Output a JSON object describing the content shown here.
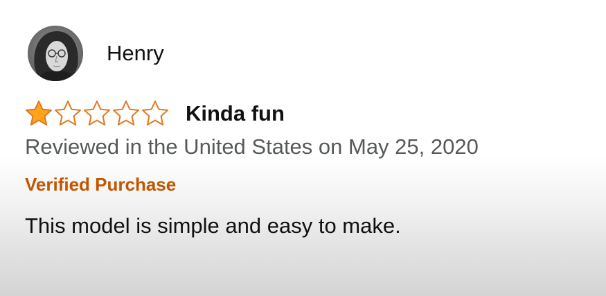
{
  "review": {
    "reviewer_name": "Henry",
    "avatar_icon": "reviewer-avatar-photo",
    "rating": {
      "filled": 1,
      "max": 5,
      "filled_color": "#ffa41c",
      "outline_color": "#de7921"
    },
    "title": "Kinda fun",
    "meta": "Reviewed in the United States on May 25, 2020",
    "verified_label": "Verified Purchase",
    "verified_color": "#c45500",
    "body": "This model is simple and easy to make."
  }
}
